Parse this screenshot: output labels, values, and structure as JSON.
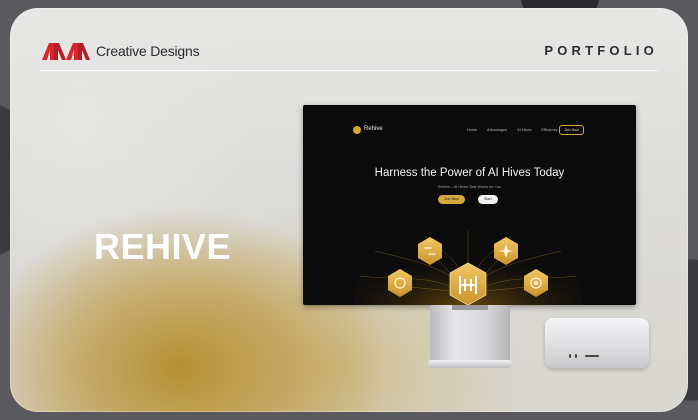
{
  "brand": {
    "name": "Creative Designs",
    "logo_color": "#d7262f"
  },
  "header": {
    "section_label": "PORTFOLIO"
  },
  "project": {
    "title": "REHIVE"
  },
  "screen": {
    "site_name": "Rehive",
    "nav_links": [
      "Home",
      "Advantages",
      "AI Hives",
      "Efficiency"
    ],
    "cta_label": "Join Now",
    "hero_title": "Harness the Power of AI Hives Today",
    "hero_subtitle": "Rehive – AI Hives That Works for You",
    "primary_button": "Join Now",
    "secondary_button": "Start",
    "accent_color": "#d4a93a",
    "icons": [
      "link-icon",
      "sparkle-icon",
      "hive-logo-icon",
      "refresh-icon",
      "target-icon"
    ]
  },
  "devices": [
    "monitor",
    "mini-pc"
  ]
}
